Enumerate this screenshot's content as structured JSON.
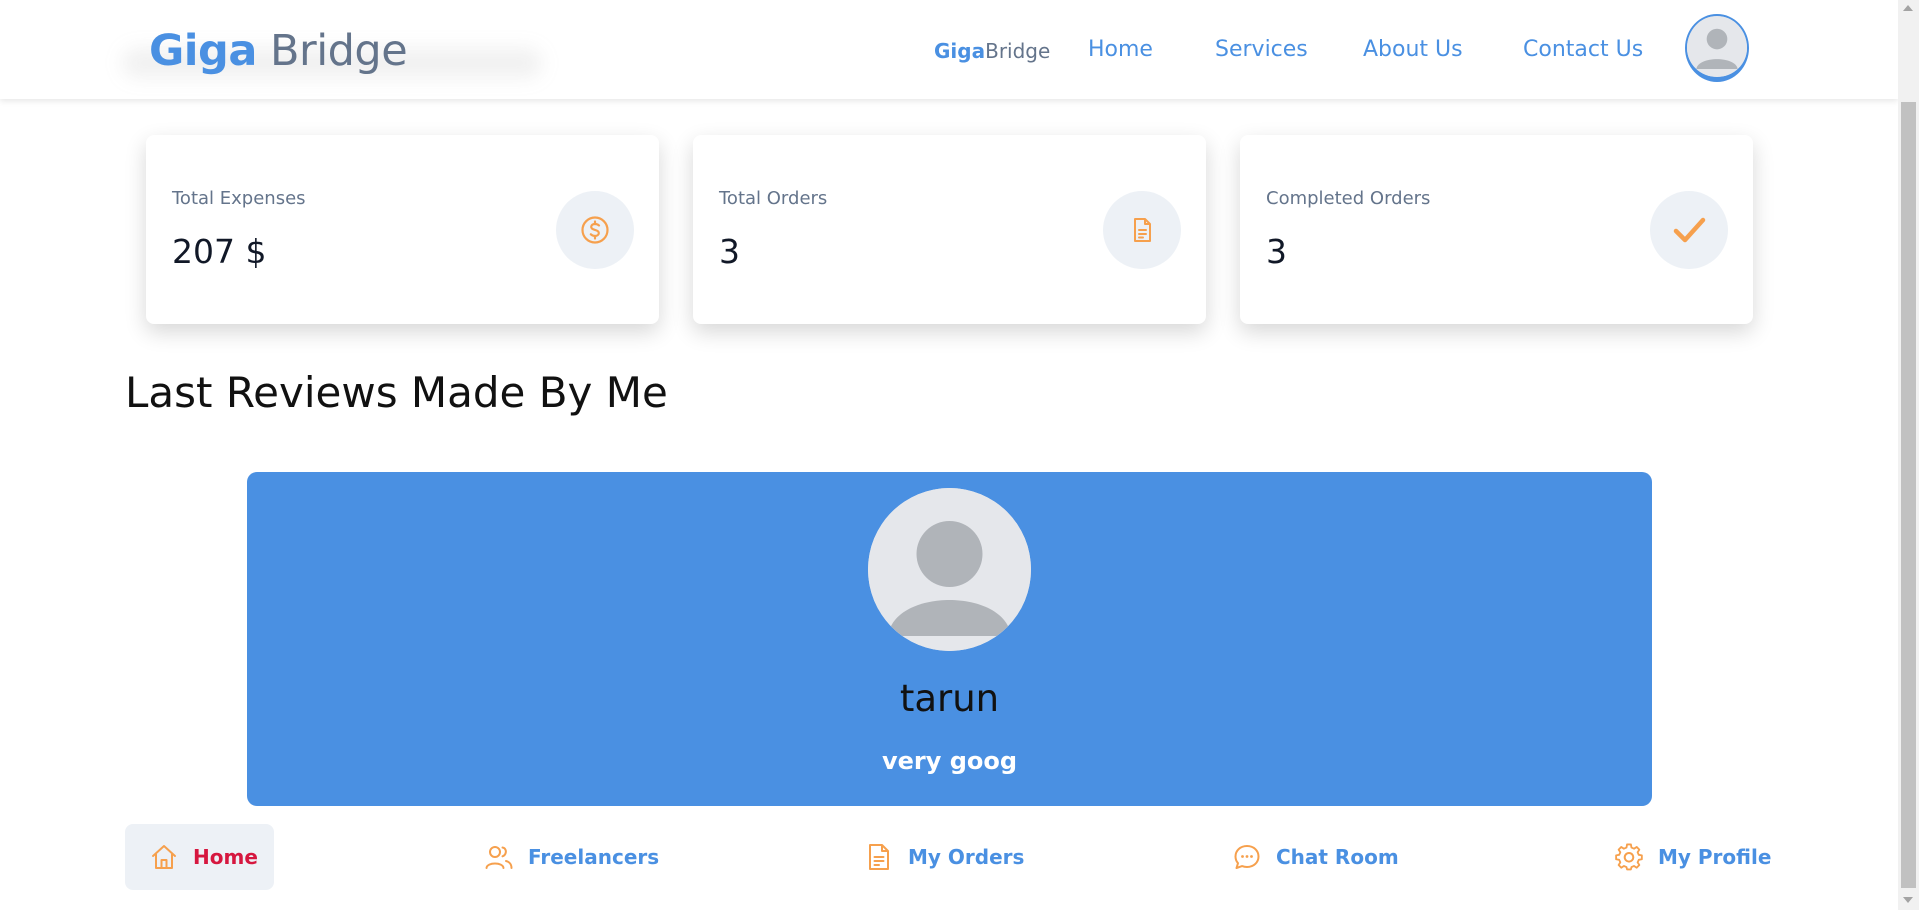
{
  "header": {
    "logo": {
      "part1": "Giga",
      "part2": "Bridge"
    },
    "mini_logo": {
      "part1": "Giga",
      "part2": "Bridge"
    },
    "nav": [
      {
        "label": "Home"
      },
      {
        "label": "Services"
      },
      {
        "label": "About Us"
      },
      {
        "label": "Contact Us"
      }
    ],
    "avatar_icon": "user-avatar-icon"
  },
  "stats": [
    {
      "label": "Total Expenses",
      "value": "207 $",
      "icon": "dollar-circle-icon"
    },
    {
      "label": "Total Orders",
      "value": "3",
      "icon": "document-icon"
    },
    {
      "label": "Completed Orders",
      "value": "3",
      "icon": "checkmark-icon"
    }
  ],
  "reviews_section": {
    "title": "Last Reviews Made By Me",
    "reviews": [
      {
        "name": "tarun",
        "text": "very goog",
        "avatar_icon": "user-avatar-icon"
      }
    ]
  },
  "bottom_nav": [
    {
      "label": "Home",
      "icon": "home-icon",
      "active": true
    },
    {
      "label": "Freelancers",
      "icon": "users-icon",
      "active": false
    },
    {
      "label": "My Orders",
      "icon": "document-icon",
      "active": false
    },
    {
      "label": "Chat Room",
      "icon": "chat-icon",
      "active": false
    },
    {
      "label": "My Profile",
      "icon": "gear-icon",
      "active": false
    }
  ],
  "colors": {
    "brand_blue": "#4a90e2",
    "slate": "#64748b",
    "accent_orange": "#f6a04d",
    "active_red": "#d6173f",
    "icon_bg": "#edf1f6"
  }
}
